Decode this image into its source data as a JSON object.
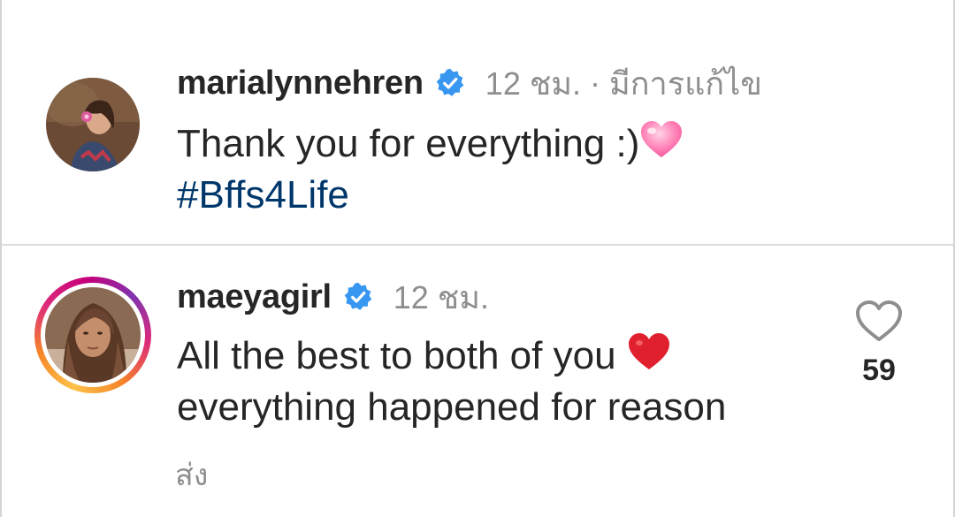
{
  "comments": [
    {
      "username": "marialynnehren",
      "verified": true,
      "time": "12 ชม.",
      "separator": "·",
      "edited_label": "มีการแก้ไข",
      "text_line1": "Thank you for everything :)",
      "text_line1_emoji": "pink-heart-emoji",
      "hashtag": "#Bffs4Life"
    },
    {
      "username": "maeyagirl",
      "verified": true,
      "time": "12 ชม.",
      "text_line1": "All the best to both of you",
      "text_line1_emoji": "red-heart-emoji",
      "text_line2": "everything happened for reason",
      "reply_label": "ส่ง",
      "like_count": "59",
      "has_story_ring": true
    }
  ],
  "colors": {
    "text": "#262626",
    "secondary": "#8e8e8e",
    "link": "#00376b",
    "verified_blue": "#3897f0",
    "divider": "#dbdbdb"
  }
}
